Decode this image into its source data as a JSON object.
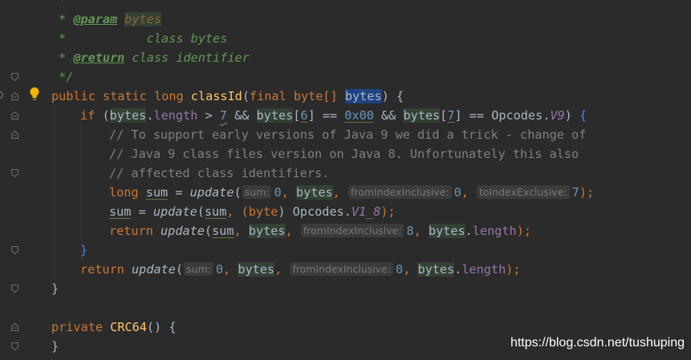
{
  "editor": {
    "doc": {
      "star": "*",
      "param_tag": "@param",
      "param_name": "bytes",
      "param_desc": "class bytes",
      "return_tag": "@return",
      "return_desc": "class identifier",
      "close": "*/"
    },
    "sig": {
      "public": "public",
      "static": "static",
      "long": "long",
      "name": "classId",
      "open": "(",
      "final": "final",
      "byte_arr": "byte[]",
      "param": "bytes",
      "close": ")",
      "brace": "{"
    },
    "if_line": {
      "if": "if",
      "p1": "(",
      "bytes1": "bytes",
      "length_dot": ".",
      "length": "length",
      "gt": " > ",
      "seven": "7",
      "and1": " && ",
      "bytes2": "bytes",
      "idx6_open": "[",
      "idx6": "6",
      "idx6_close": "]",
      "eq1": " == ",
      "hex": "0x00",
      "and2": " && ",
      "bytes3": "bytes",
      "idx7_open": "[",
      "idx7": "7",
      "idx7_close": "]",
      "eq2": " == ",
      "opcodes": "Opcodes.",
      "v9": "V9",
      "p2": ")",
      "brace": "{"
    },
    "comments": [
      "// To support early versions of Java 9 we did a trick - change of",
      "// Java 9 class files version on Java 8. Unfortunately this also",
      "// affected class identifiers."
    ],
    "line_sum1": {
      "long": "long",
      "sum": "sum",
      "eq": " = ",
      "fn": "update",
      "open": "(",
      "hint_sum": "sum:",
      "zero": "0",
      "c1": ", ",
      "bytes": "bytes",
      "c2": ", ",
      "hint_from": "fromIndexInclusive:",
      "zero2": "0",
      "c3": ", ",
      "hint_to": "toIndexExclusive:",
      "seven": "7",
      "close": ");"
    },
    "line_sum2": {
      "sum": "sum",
      "eq": " = ",
      "fn": "update",
      "open": "(",
      "sum_arg": "sum",
      "c1": ", (",
      "byte": "byte",
      "cast_close": ") ",
      "opcodes": "Opcodes.",
      "v1_8": "V1_8",
      "close": ");"
    },
    "line_ret1": {
      "return": "return",
      "fn": "update",
      "open": "(",
      "sum_arg": "sum",
      "c1": ", ",
      "bytes": "bytes",
      "c2": ", ",
      "hint_from": "fromIndexInclusive:",
      "eight": "8",
      "c3": ", ",
      "bytes2": "bytes",
      "dot": ".",
      "length": "length",
      "close": ");"
    },
    "close_if": "}",
    "line_ret2": {
      "return": "return",
      "fn": "update",
      "open": "(",
      "hint_sum": "sum:",
      "zero": "0",
      "c1": ", ",
      "bytes": "bytes",
      "c2": ", ",
      "hint_from": "fromIndexInclusive:",
      "zero2": "0",
      "c3": ", ",
      "bytes2": "bytes",
      "dot": ".",
      "length": "length",
      "close": ");"
    },
    "close_method": "}",
    "ctor": {
      "private": "private",
      "name": "CRC64",
      "parens": "()",
      "brace": "{"
    },
    "close_ctor": "}"
  },
  "watermark": "https://blog.csdn.net/tushuping",
  "colors": {
    "background": "#2b2b2b",
    "keyword": "#cc7832",
    "comment": "#808080",
    "javadoc": "#629755",
    "method": "#ffc66d",
    "number": "#6897bb",
    "field": "#9876aa"
  }
}
